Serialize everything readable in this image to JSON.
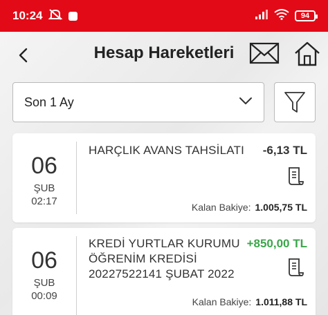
{
  "status_bar": {
    "time": "10:24",
    "battery": "94"
  },
  "header": {
    "title": "Hesap Hareketleri"
  },
  "filter": {
    "period": "Son 1 Ay"
  },
  "transactions": [
    {
      "day": "06",
      "month": "ŞUB",
      "time": "02:17",
      "description": [
        "HARÇLIK AVANS TAHSİLATI"
      ],
      "amount": "-6,13 TL",
      "balance_label": "Kalan Bakiye:",
      "balance": "1.005,75 TL"
    },
    {
      "day": "06",
      "month": "ŞUB",
      "time": "00:09",
      "description": [
        "KREDİ YURTLAR KURUMU",
        "ÖĞRENİM KREDİSİ",
        "20227522141 ŞUBAT 2022"
      ],
      "amount": "+850,00 TL",
      "balance_label": "Kalan Bakiye:",
      "balance": "1.011,88 TL"
    }
  ],
  "colors": {
    "brand": "#e30a17",
    "positive": "#3aa64a"
  }
}
